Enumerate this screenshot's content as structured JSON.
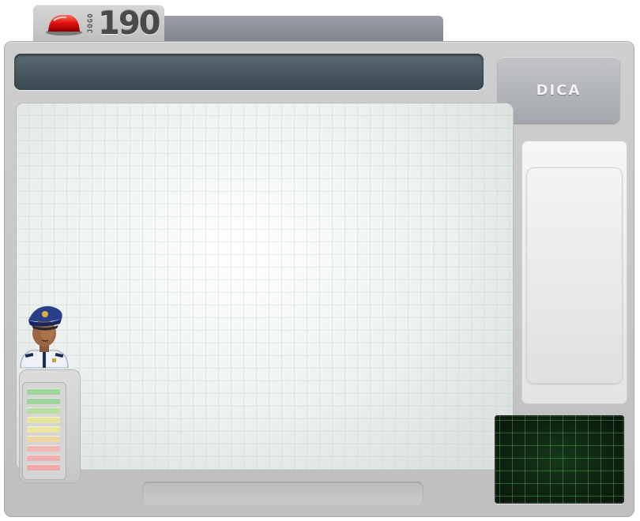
{
  "logo": {
    "side_text": "JOGO",
    "number": "190",
    "icon": "siren-icon"
  },
  "title_bar": {
    "text": ""
  },
  "dica_button": {
    "label": "DICA"
  },
  "meter": {
    "segments": [
      {
        "color": "#9fd49a"
      },
      {
        "color": "#9fd49a"
      },
      {
        "color": "#b7dea0"
      },
      {
        "color": "#e6e69a"
      },
      {
        "color": "#ece6a0"
      },
      {
        "color": "#eed8a2"
      },
      {
        "color": "#efb8b4"
      },
      {
        "color": "#efb0b0"
      },
      {
        "color": "#eea9a9"
      }
    ]
  },
  "colors": {
    "title_bar": "#3f4e56",
    "radar_bg": "#0d1a0e",
    "radar_grid": "#3ca046"
  }
}
